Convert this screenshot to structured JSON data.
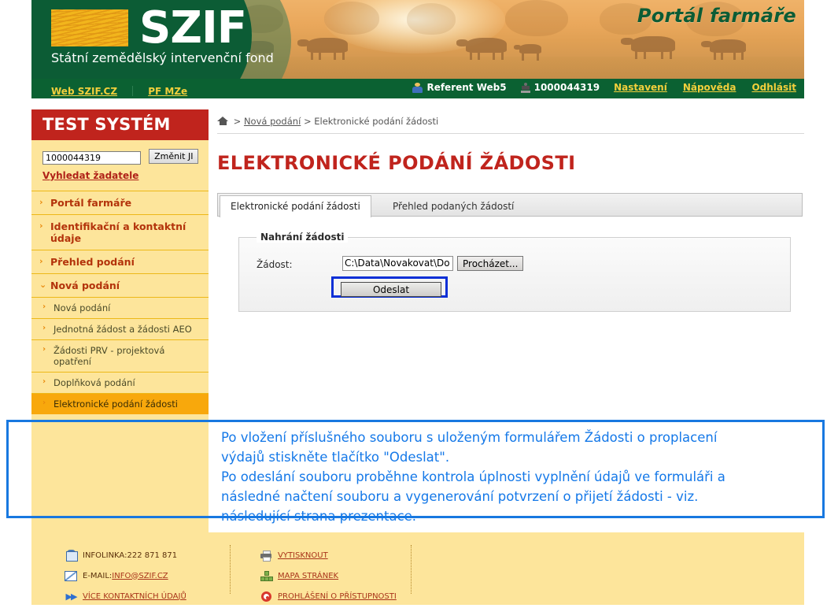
{
  "header": {
    "logo_word": "SZIF",
    "logo_subtitle": "Státní zemědělský intervenční fond",
    "portal_title": "Portál farmáře"
  },
  "navbar": {
    "left_links": [
      {
        "label": "Web SZIF.CZ",
        "name": "nav-web-szif"
      },
      {
        "label": "PF MZe",
        "name": "nav-pf-mze"
      }
    ],
    "user_role": "Referent Web5",
    "user_id": "1000044319",
    "right_links": [
      {
        "label": "Nastavení",
        "name": "nav-nastaveni"
      },
      {
        "label": "Nápověda",
        "name": "nav-napoveda"
      },
      {
        "label": "Odhlásit",
        "name": "nav-odhlasit"
      }
    ]
  },
  "sidebar": {
    "title": "TEST SYSTÉM",
    "ji_value": "1000044319",
    "ji_button": "Změnit JI",
    "search_link": "Vyhledat žadatele",
    "items": [
      {
        "label": "Portál farmáře",
        "chevron": "›"
      },
      {
        "label": "Identifikační a kontaktní údaje",
        "chevron": "›"
      },
      {
        "label": "Přehled podání",
        "chevron": "›"
      },
      {
        "label": "Nová podání",
        "chevron": "⌄"
      }
    ],
    "subitems": [
      {
        "label": "Nová podání",
        "chevron": "›",
        "active": false
      },
      {
        "label": "Jednotná žádost a žádosti AEO",
        "chevron": "›",
        "active": false
      },
      {
        "label": "Žádosti PRV - projektová opatření",
        "chevron": "›",
        "active": false
      },
      {
        "label": "Doplňková podání",
        "chevron": "›",
        "active": false
      },
      {
        "label": "Elektronické podání žádosti",
        "chevron": "›",
        "active": true
      }
    ]
  },
  "breadcrumb": {
    "home_icon": "home-icon",
    "sep1": ">",
    "link": "Nová podání",
    "sep2": ">",
    "current": "Elektronické podání žádosti"
  },
  "page": {
    "title": "ELEKTRONICKÉ PODÁNÍ ŽÁDOSTI"
  },
  "tabs": [
    {
      "label": "Elektronické podání žádosti",
      "selected": true
    },
    {
      "label": "Přehled podaných žádostí",
      "selected": false
    }
  ],
  "form": {
    "legend": "Nahrání žádosti",
    "field_label": "Žádost:",
    "file_value": "C:\\Data\\Novakovat\\Do",
    "browse_button": "Procházet...",
    "submit_button": "Odeslat"
  },
  "annotation": {
    "border_color": "#1878e0",
    "text_color": "#1478e8",
    "lines": [
      "Po vložení příslušného souboru s uloženým formulářem Žádosti o proplacení",
      "výdajů stiskněte tlačítko \"Odeslat\".",
      "Po odeslání souboru proběhne kontrola úplnosti vyplnění údajů ve formuláři a",
      "následné načtení souboru a vygenerování potvrzení o přijetí žádosti - viz.",
      "následující strana prezentace."
    ]
  },
  "footer": {
    "col1": [
      {
        "icon": "phone-icon",
        "prefix": "INFOLINKA: ",
        "link": "",
        "suffix": "222 871 871"
      },
      {
        "icon": "mail-icon",
        "prefix": "E-MAIL: ",
        "link": "INFO@SZIF.CZ",
        "suffix": ""
      },
      {
        "icon": "double-arrow-icon",
        "prefix": "",
        "link": "VÍCE KONTAKTNÍCH ÚDAJŮ",
        "suffix": ""
      }
    ],
    "col2": [
      {
        "icon": "printer-icon",
        "prefix": "",
        "link": "VYTISKNOUT",
        "suffix": ""
      },
      {
        "icon": "sitemap-icon",
        "prefix": "",
        "link": "MAPA STRÁNEK",
        "suffix": ""
      },
      {
        "icon": "accessibility-icon",
        "prefix": "",
        "link": "PROHLÁŠENÍ O PŘÍSTUPNOSTI",
        "suffix": ""
      }
    ]
  },
  "colors": {
    "green": "#0c5c35",
    "red": "#c0241d",
    "yellow": "#fde59b",
    "orange": "#f8a80c",
    "blue": "#1878e0"
  }
}
